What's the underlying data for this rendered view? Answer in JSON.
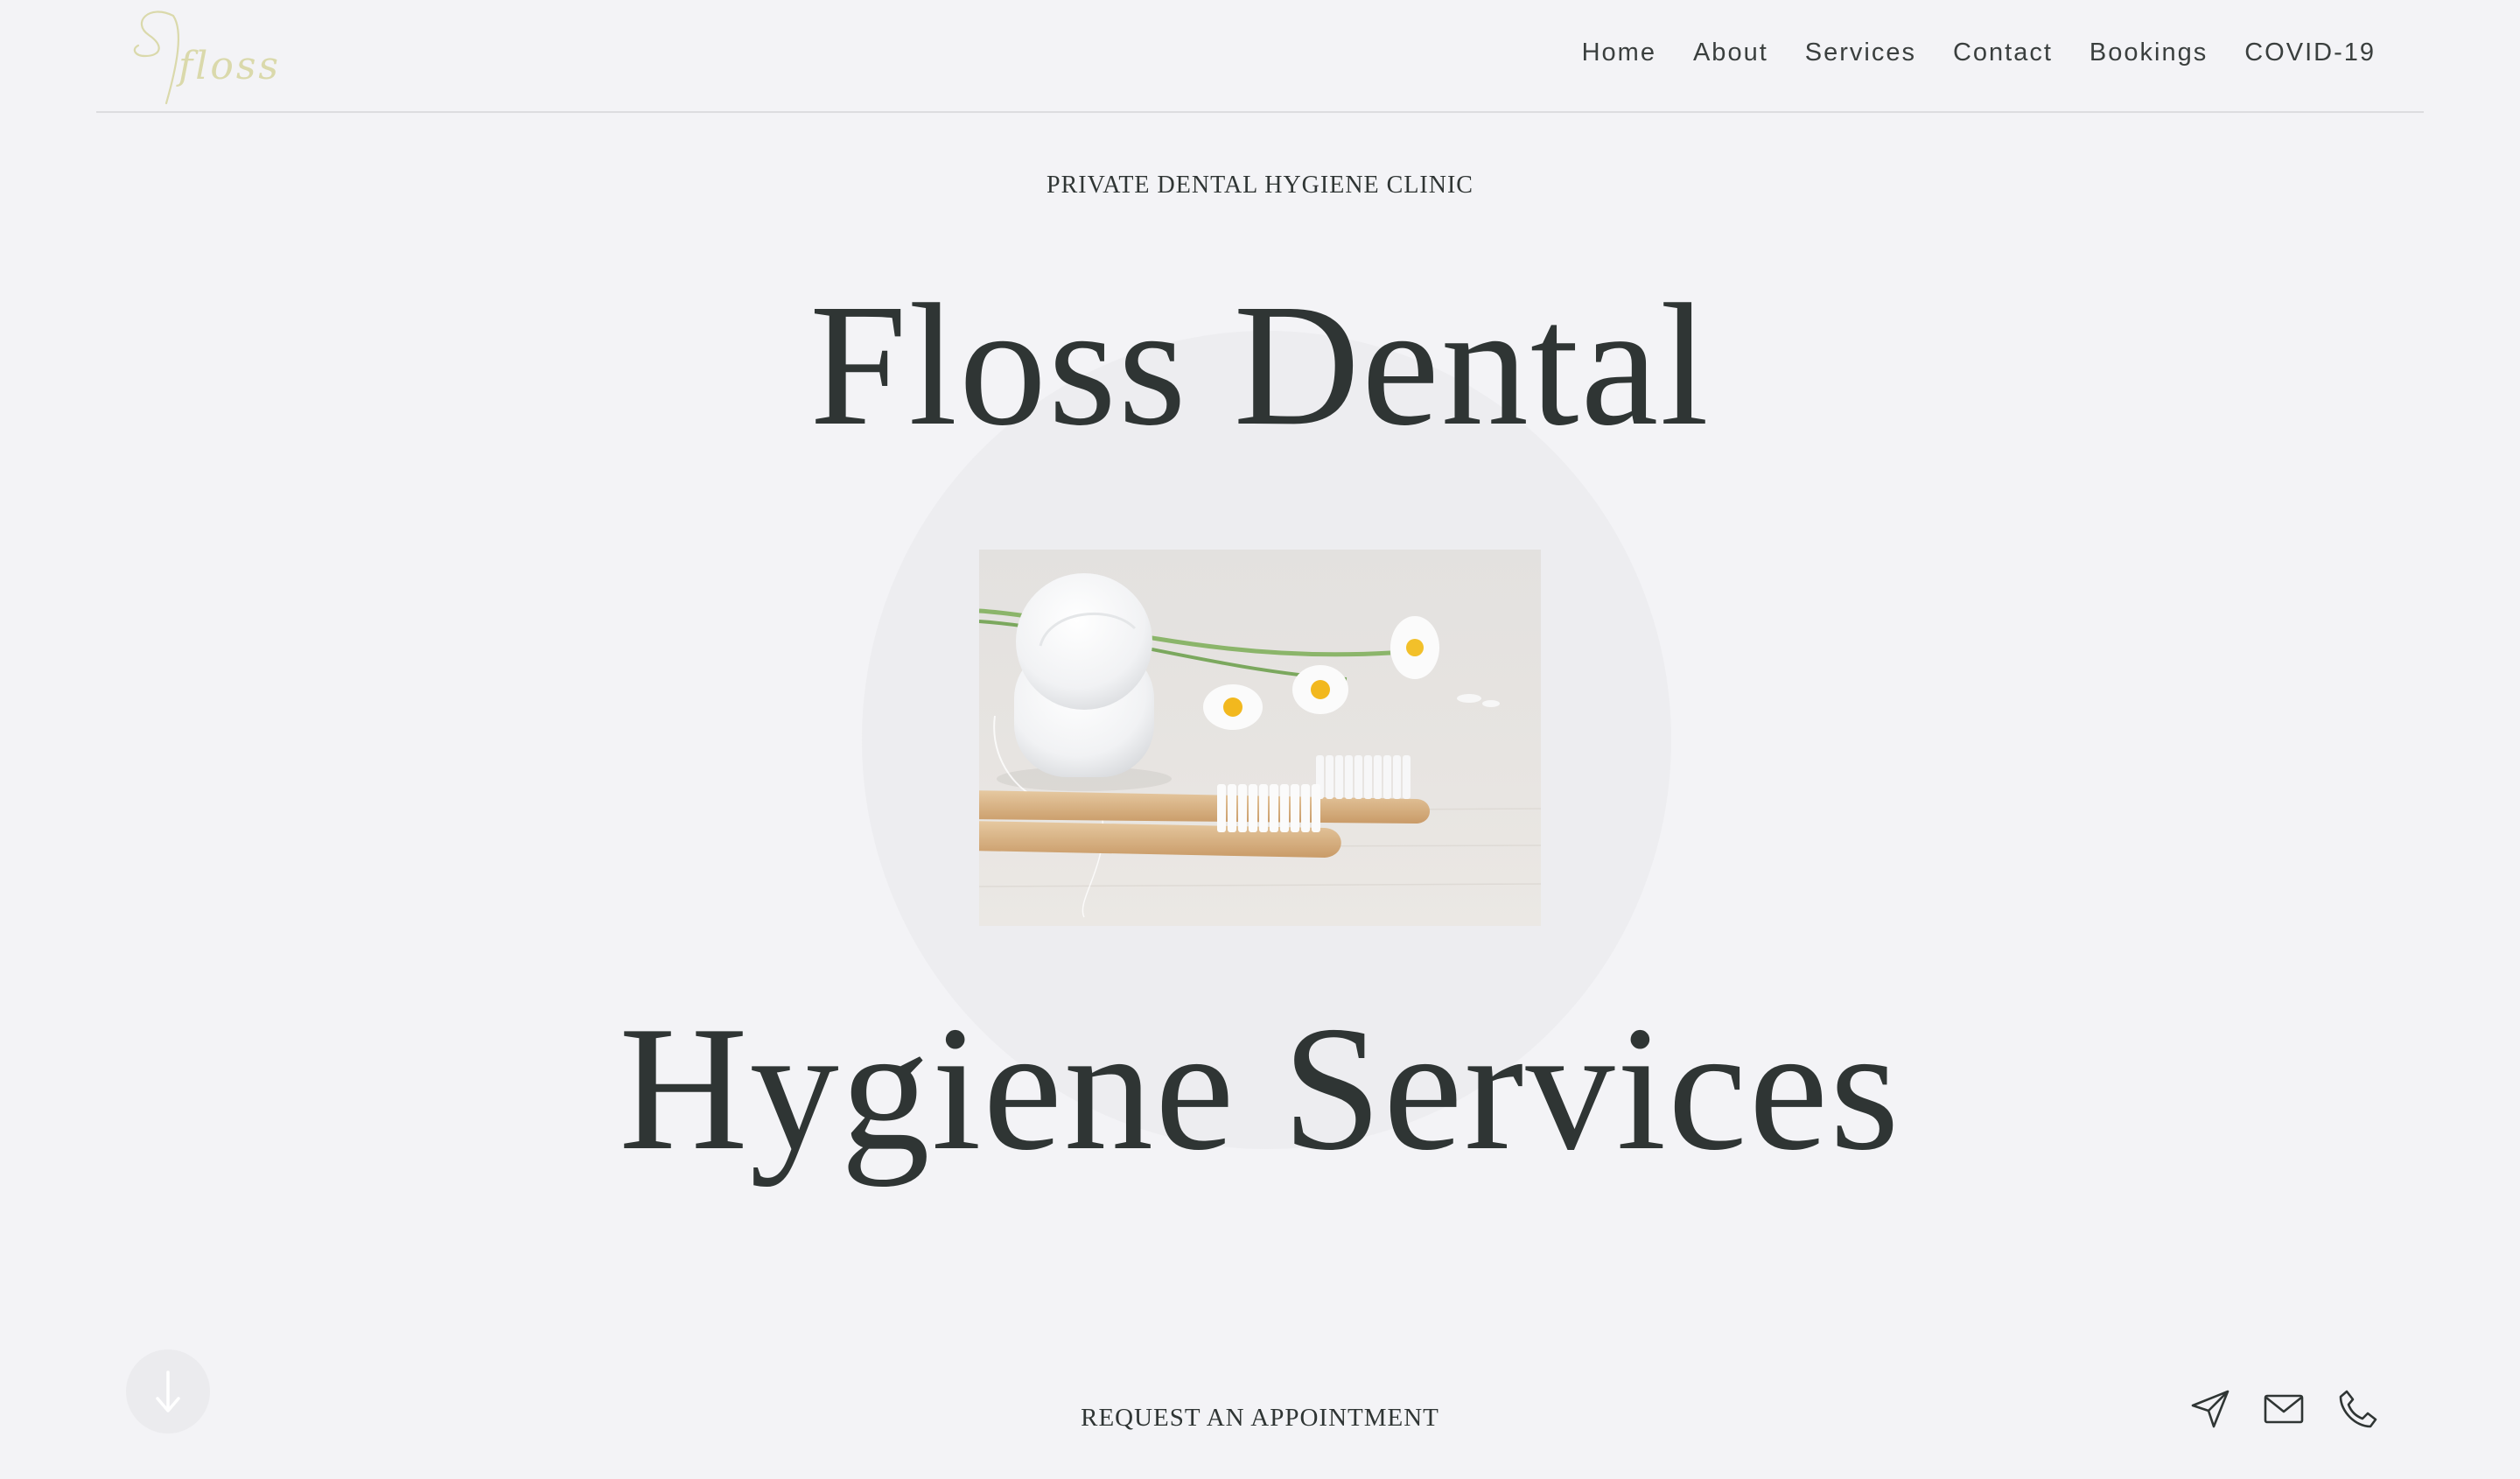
{
  "header": {
    "logo_text": "floss",
    "nav": [
      {
        "label": "Home"
      },
      {
        "label": "About"
      },
      {
        "label": "Services"
      },
      {
        "label": "Contact"
      },
      {
        "label": "Bookings"
      },
      {
        "label": "COVID-19"
      }
    ]
  },
  "hero": {
    "eyebrow": "PRIVATE DENTAL HYGIENE CLINIC",
    "title_line_1": "Floss Dental",
    "title_line_2": "Hygiene Services",
    "image_subject": "dental floss container with bamboo toothbrushes and daisies"
  },
  "footer": {
    "cta_label": "REQUEST AN APPOINTMENT",
    "scroll_icon": "arrow-down-icon",
    "contact_icons": [
      "send-icon",
      "mail-icon",
      "phone-icon"
    ]
  },
  "colors": {
    "background": "#f3f3f6",
    "text": "#2f3534",
    "logo": "#dad9ab",
    "circle": "#ededf0"
  }
}
